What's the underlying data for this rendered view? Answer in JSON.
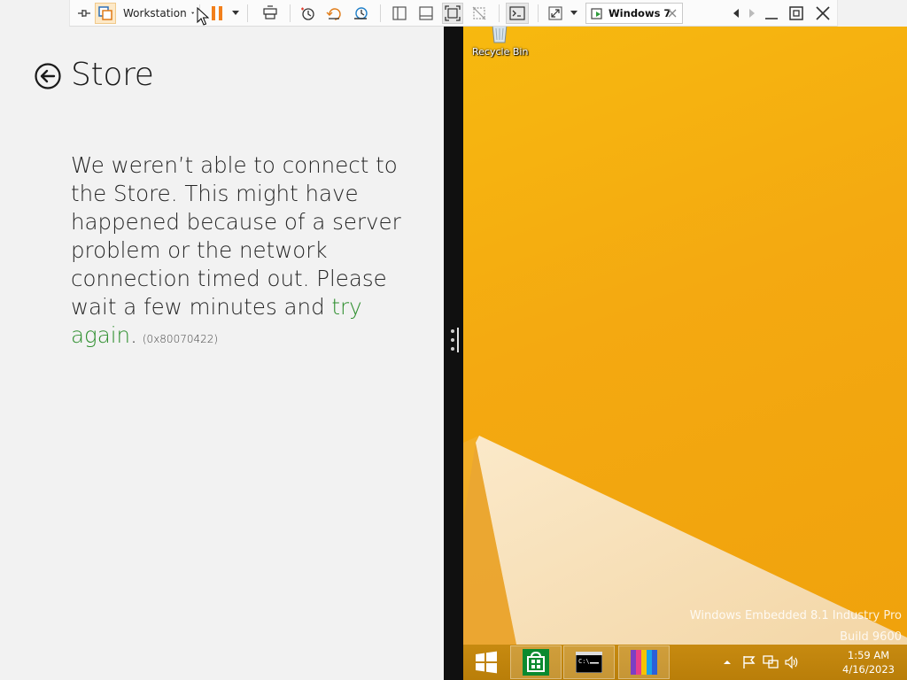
{
  "store": {
    "title": "Store",
    "message_main": "We weren’t able to connect to the Store. This might have happened because of a server problem or the network connection timed out. Please wait a few minutes and ",
    "try_again": "try again",
    "period": ".",
    "error_code": "(0x80070422)"
  },
  "toolbar": {
    "workstation_label": "Workstation",
    "tab_label": "Windows 7",
    "icons": [
      "pin-icon",
      "unity-icon",
      "pause-icon",
      "send-keys-icon",
      "snapshot-icon",
      "revert-snapshot-icon",
      "snapshot-manager-icon",
      "library-icon",
      "thumbnail-icon",
      "fullscreen-icon",
      "unity-mode-icon",
      "console-icon",
      "stretch-icon"
    ]
  },
  "desktop": {
    "recycle_bin_label": "Recycle Bin",
    "watermark_line1": "Windows Embedded 8.1 Industry Pro",
    "watermark_line2": "Build 9600"
  },
  "taskbar": {
    "time": "1:59 AM",
    "date": "4/16/2023"
  },
  "colors": {
    "link_green": "#2f8f2f",
    "desktop_orange": "#f4a911",
    "taskbar": "#c88a0e"
  }
}
